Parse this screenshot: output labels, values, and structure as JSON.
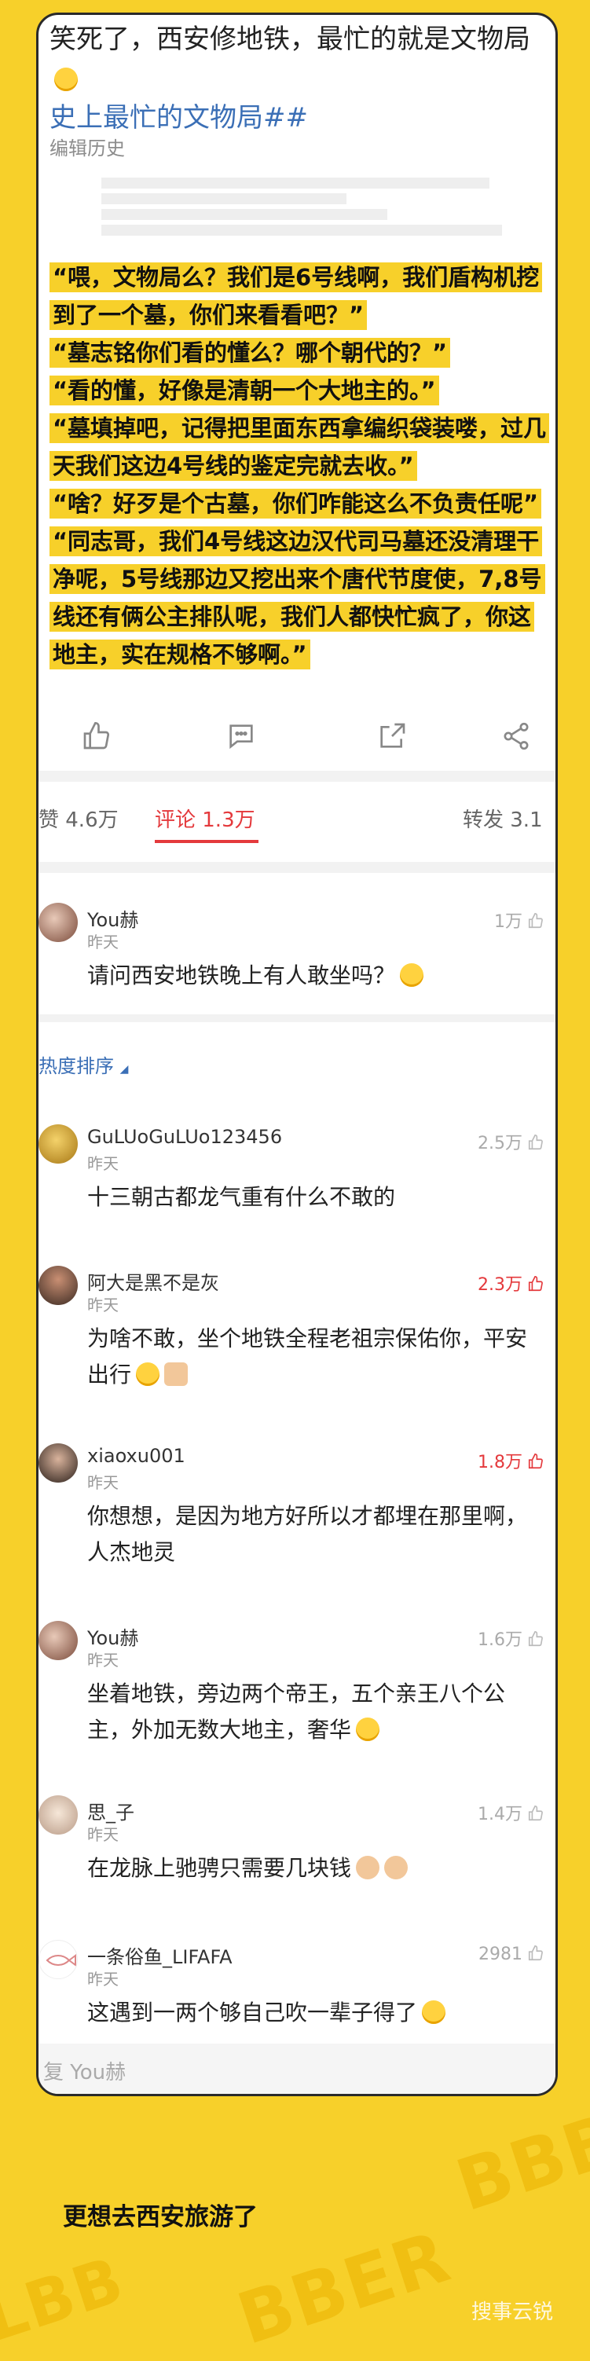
{
  "post": {
    "text": "笑死了，西安修地铁，最忙的就是文物局",
    "topic": "史上最忙的文物局##",
    "edit_history": "编辑历史",
    "quote_lines": [
      "“喂，文物局么？我们是6号线啊，我们盾构机挖到了一个墓，你们来看看吧？”",
      "“墓志铭你们看的懂么？哪个朝代的？”",
      "“看的懂，好像是清朝一个大地主的。”",
      "“墓填掉吧，记得把里面东西拿编织袋装喽，过几天我们这边4号线的鉴定完就去收。”",
      "“啥？好歹是个古墓，你们咋能这么不负责任呢”",
      "“同志哥，我们4号线这边汉代司马墓还没清理干净呢，5号线那边又挖出来个唐代节度使，7,8号线还有俩公主排队呢，我们人都快忙疯了，你这地主，实在规格不够啊。”"
    ]
  },
  "tabs": {
    "likes": "赞 4.6万",
    "comments": "评论 1.3万",
    "reposts": "转发 3.1"
  },
  "sort_label": "热度排序",
  "comments": [
    {
      "user": "You赫",
      "time": "昨天",
      "likes": "1万",
      "hot": false,
      "text": "请问西安地铁晚上有人敢坐吗？"
    },
    {
      "user": "GuLUoGuLUo123456",
      "time": "昨天",
      "likes": "2.5万",
      "hot": false,
      "text": "十三朝古都龙气重有什么不敢的"
    },
    {
      "user": "阿大是黑不是灰",
      "time": "昨天",
      "likes": "2.3万",
      "hot": true,
      "text": "为啥不敢，坐个地铁全程老祖宗保佑你，平安出行"
    },
    {
      "user": "xiaoxu001",
      "time": "昨天",
      "likes": "1.8万",
      "hot": true,
      "text": "你想想，是因为地方好所以才都埋在那里啊，人杰地灵"
    },
    {
      "user": "You赫",
      "time": "昨天",
      "likes": "1.6万",
      "hot": false,
      "text": "坐着地铁，旁边两个帝王，五个亲王八个公主，外加无数大地主，奢华"
    },
    {
      "user": "思_子",
      "time": "昨天",
      "likes": "1.4万",
      "hot": false,
      "text": "在龙脉上驰骋只需要几块钱"
    },
    {
      "user": "一条俗鱼_LIFAFA",
      "time": "昨天",
      "likes": "2981",
      "hot": false,
      "text": "这遇到一两个够自己吹一辈子得了"
    }
  ],
  "reply_placeholder": "复 You赫",
  "caption": "更想去西安旅游了",
  "watermark": "搜事云锐",
  "colors": {
    "frame": "#f7d02a",
    "accent": "#e4393c",
    "link": "#3b6fb6",
    "highlight": "#f7d02a"
  },
  "icons": [
    "like-icon",
    "comment-icon",
    "repost-icon",
    "share-icon",
    "thumb-icon",
    "emoji-icon"
  ]
}
